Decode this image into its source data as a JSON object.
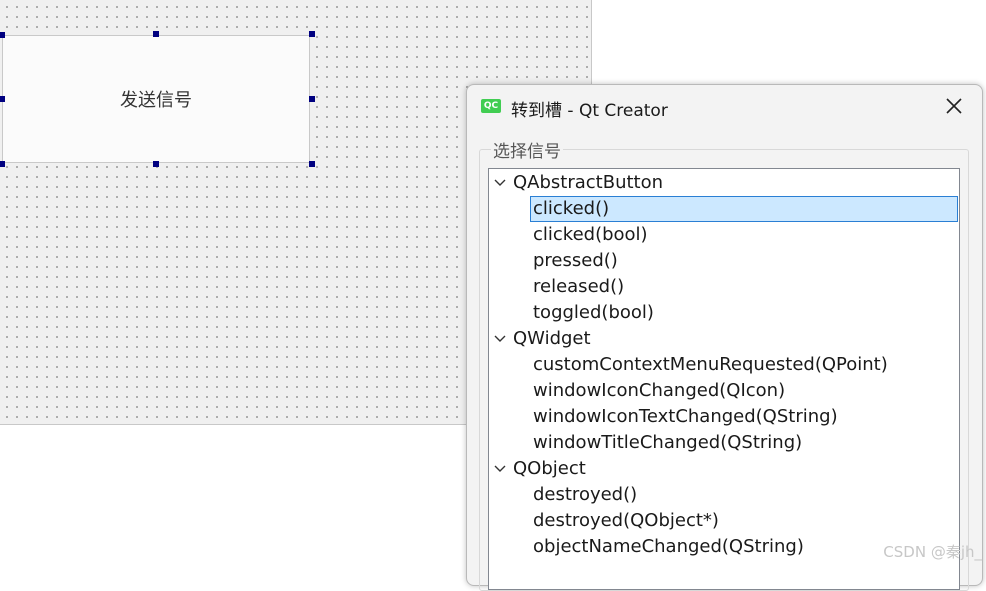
{
  "form": {
    "button_label": "发送信号"
  },
  "dialog": {
    "app_icon_text": "QC",
    "title": "转到槽 - Qt Creator",
    "group_label": "选择信号",
    "tree": [
      {
        "type": "group",
        "label": "QAbstractButton"
      },
      {
        "type": "child",
        "label": "clicked()",
        "selected": true
      },
      {
        "type": "child",
        "label": "clicked(bool)"
      },
      {
        "type": "child",
        "label": "pressed()"
      },
      {
        "type": "child",
        "label": "released()"
      },
      {
        "type": "child",
        "label": "toggled(bool)"
      },
      {
        "type": "group",
        "label": "QWidget"
      },
      {
        "type": "child",
        "label": "customContextMenuRequested(QPoint)"
      },
      {
        "type": "child",
        "label": "windowIconChanged(QIcon)"
      },
      {
        "type": "child",
        "label": "windowIconTextChanged(QString)"
      },
      {
        "type": "child",
        "label": "windowTitleChanged(QString)"
      },
      {
        "type": "group",
        "label": "QObject"
      },
      {
        "type": "child",
        "label": "destroyed()"
      },
      {
        "type": "child",
        "label": "destroyed(QObject*)"
      },
      {
        "type": "child",
        "label": "objectNameChanged(QString)"
      }
    ]
  },
  "watermark": "CSDN @秦jh_"
}
